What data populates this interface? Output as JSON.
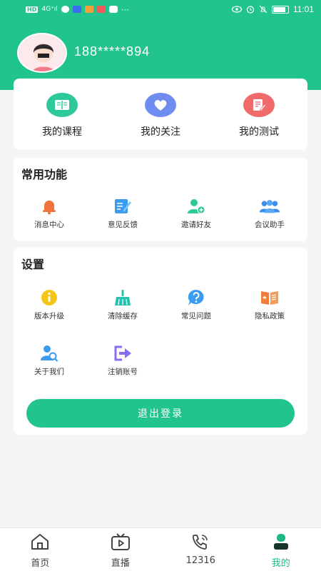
{
  "status_bar": {
    "network": "HD",
    "signal": "4G⁺ıl",
    "dots": "⋯",
    "time": "11:01",
    "battery_level": 0.85
  },
  "profile": {
    "username": "188*****894"
  },
  "quick_links": [
    {
      "label": "我的课程",
      "icon": "book-icon",
      "color": "#2ec99a"
    },
    {
      "label": "我的关注",
      "icon": "heart-icon",
      "color": "#6f8cf0"
    },
    {
      "label": "我的测试",
      "icon": "edit-note-icon",
      "color": "#ef6b6b"
    }
  ],
  "common": {
    "title": "常用功能",
    "items": [
      {
        "label": "消息中心",
        "icon": "bell-icon",
        "color": "#f0733a"
      },
      {
        "label": "意见反馈",
        "icon": "feedback-icon",
        "color": "#3a9cf0"
      },
      {
        "label": "邀请好友",
        "icon": "add-user-icon",
        "color": "#2ec99a"
      },
      {
        "label": "会议助手",
        "icon": "group-icon",
        "color": "#3a8ef0"
      }
    ]
  },
  "settings": {
    "title": "设置",
    "items": [
      {
        "label": "版本升级",
        "icon": "info-icon",
        "color": "#f5c518"
      },
      {
        "label": "清除缓存",
        "icon": "broom-icon",
        "color": "#26c2b0"
      },
      {
        "label": "常见问题",
        "icon": "question-icon",
        "color": "#3a9cf0"
      },
      {
        "label": "隐私政策",
        "icon": "privacy-book-icon",
        "color": "#f27c3a"
      },
      {
        "label": "关于我们",
        "icon": "user-search-icon",
        "color": "#3a9cf0"
      },
      {
        "label": "注销账号",
        "icon": "logout-arrow-icon",
        "color": "#8a6cf0"
      }
    ],
    "logout_label": "退出登录"
  },
  "bottom_nav": [
    {
      "label": "首页",
      "icon": "home-icon",
      "active": false
    },
    {
      "label": "直播",
      "icon": "tv-play-icon",
      "active": false
    },
    {
      "label": "12316",
      "icon": "phone-icon",
      "active": false
    },
    {
      "label": "我的",
      "icon": "profile-icon",
      "active": true
    }
  ],
  "colors": {
    "brand": "#22c48e",
    "background": "#f4f5f6",
    "active_nav": "#1eb883"
  }
}
